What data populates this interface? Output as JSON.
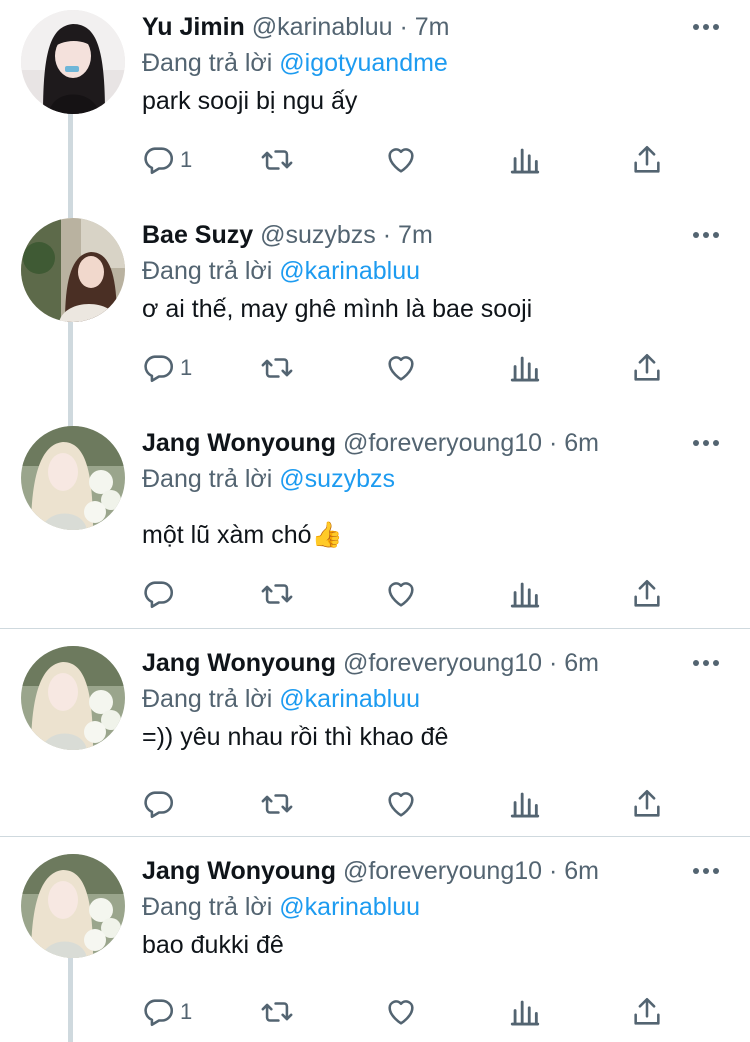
{
  "tweets": [
    {
      "name": "Yu Jimin",
      "handle": "@karinabluu",
      "dot": "·",
      "time": "7m",
      "reply_prefix": "Đang trả lời",
      "reply_to": "@igotyuandme",
      "text": "park sooji bị ngu ấy",
      "reply_count": "1",
      "avatar": "avatar-dark-hair"
    },
    {
      "name": "Bae Suzy",
      "handle": "@suzybzs",
      "dot": "·",
      "time": "7m",
      "reply_prefix": "Đang trả lời",
      "reply_to": "@karinabluu",
      "text": "ơ ai thế, may ghê mình là bae sooji",
      "reply_count": "1",
      "avatar": "avatar-outdoor"
    },
    {
      "name": "Jang Wonyoung",
      "handle": "@foreveryoung10",
      "dot": "·",
      "time": "6m",
      "reply_prefix": "Đang trả lời",
      "reply_to": "@suzybzs",
      "text": "một lũ xàm chó👍",
      "reply_count": "",
      "avatar": "avatar-flowers"
    },
    {
      "name": "Jang Wonyoung",
      "handle": "@foreveryoung10",
      "dot": "·",
      "time": "6m",
      "reply_prefix": "Đang trả lời",
      "reply_to": "@karinabluu",
      "text": "=)) yêu nhau rồi thì khao đê",
      "reply_count": "",
      "avatar": "avatar-flowers"
    },
    {
      "name": "Jang Wonyoung",
      "handle": "@foreveryoung10",
      "dot": "·",
      "time": "6m",
      "reply_prefix": "Đang trả lời",
      "reply_to": "@karinabluu",
      "text": "bao đukki đê",
      "reply_count": "1",
      "avatar": "avatar-flowers"
    }
  ],
  "icons": {
    "reply": "reply-icon",
    "retweet": "retweet-icon",
    "like": "heart-icon",
    "analytics": "analytics-icon",
    "share": "share-icon",
    "more": "more-icon"
  },
  "colors": {
    "mention": "#1d9bf0",
    "secondary_text": "#536471",
    "thread_line": "#cfd9de"
  }
}
